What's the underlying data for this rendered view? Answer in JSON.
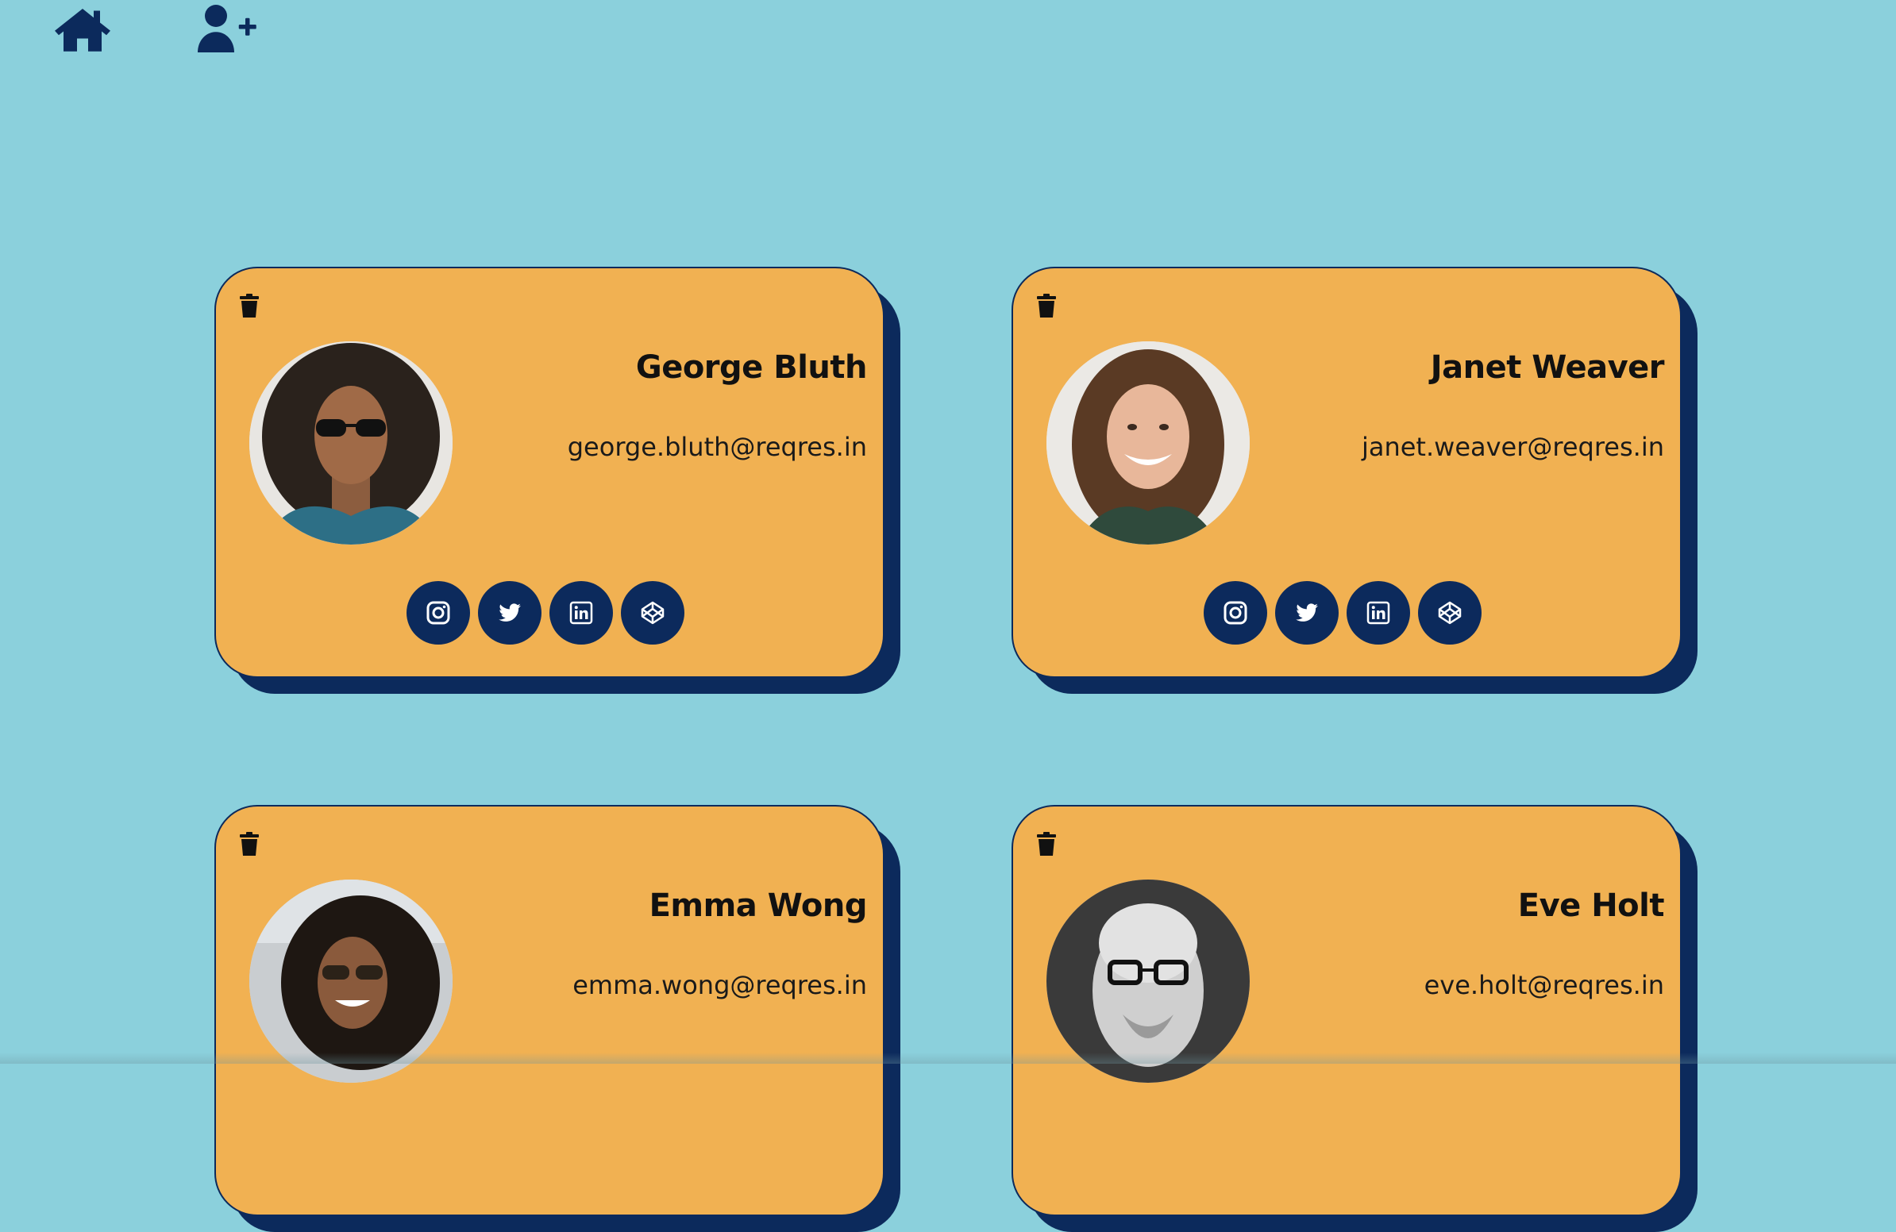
{
  "nav": {
    "home_icon": "home-icon",
    "add_user_icon": "user-plus-icon"
  },
  "colors": {
    "background": "#8bd0dc",
    "card": "#f1b152",
    "accent_navy": "#0c2a5c"
  },
  "social_icons": [
    "instagram-icon",
    "twitter-icon",
    "linkedin-icon",
    "codepen-icon"
  ],
  "users": [
    {
      "name": "George Bluth",
      "email": "george.bluth@reqres.in"
    },
    {
      "name": "Janet Weaver",
      "email": "janet.weaver@reqres.in"
    },
    {
      "name": "Emma Wong",
      "email": "emma.wong@reqres.in"
    },
    {
      "name": "Eve Holt",
      "email": "eve.holt@reqres.in"
    }
  ]
}
